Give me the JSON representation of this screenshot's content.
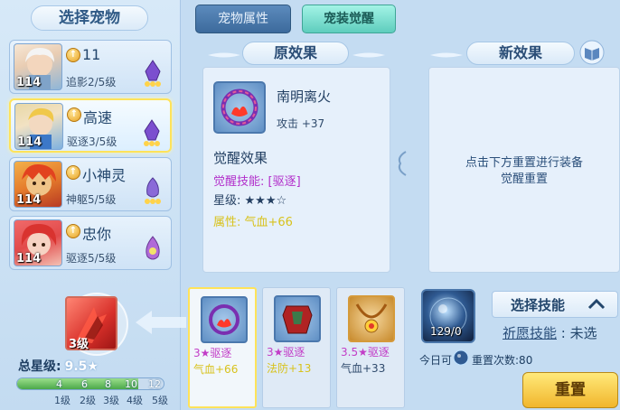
{
  "left": {
    "title": "选择宠物",
    "pets": [
      {
        "level": "114",
        "name": "11",
        "skill": "追影2/5级"
      },
      {
        "level": "114",
        "name": "高速",
        "skill": "驱逐3/5级"
      },
      {
        "level": "114",
        "name": "小神灵",
        "skill": "神躯5/5级"
      },
      {
        "level": "114",
        "name": "忠你",
        "skill": "驱逐5/5级"
      }
    ],
    "emblem_level": "3级",
    "total_star_label": "总星级:",
    "total_star_value": "9.5★",
    "progress": {
      "fill_fraction": 0.83,
      "ticks": [
        "4",
        "6",
        "8",
        "10",
        "12"
      ],
      "levels": [
        "1级",
        "2级",
        "3级",
        "4级",
        "5级"
      ]
    }
  },
  "tabs": {
    "attr": "宠物属性",
    "awaken": "宠装觉醒"
  },
  "original": {
    "title": "原效果",
    "item_name": "南明离火",
    "item_stat": "攻击 +37",
    "awake_heading": "觉醒效果",
    "awake_skill": "觉醒技能: [驱逐]",
    "awake_star": "星级: ★★★☆",
    "awake_attr": "属性: 气血+66"
  },
  "new_effect": {
    "title": "新效果",
    "hint_line1": "点击下方重置进行装备",
    "hint_line2": "觉醒重置"
  },
  "slots": [
    {
      "line1": "3★驱逐",
      "line2": "气血+66",
      "line2_color": "#d8c21c"
    },
    {
      "line1": "3★驱逐",
      "line2": "法防+13",
      "line2_color": "#d8c21c"
    },
    {
      "line1": "3.5★驱逐",
      "line2": "气血+33",
      "line2_color": "#2f4a6c"
    }
  ],
  "reset": {
    "orb_count": "129/0",
    "skill_select_label": "选择技能",
    "wish_label": "祈愿技能",
    "wish_value": "未选",
    "daily_prefix": "今日可",
    "daily_suffix": "重置次数:80",
    "reset_button": "重置"
  },
  "colors": {
    "accent_tab": "#5ecdbd",
    "selected_border": "#ffe35a",
    "skill_purple": "#b22fcb",
    "attr_yellow": "#d8c21c"
  },
  "icons": [
    "book-icon",
    "chevron-up-icon",
    "orb-icon",
    "element-icon"
  ]
}
